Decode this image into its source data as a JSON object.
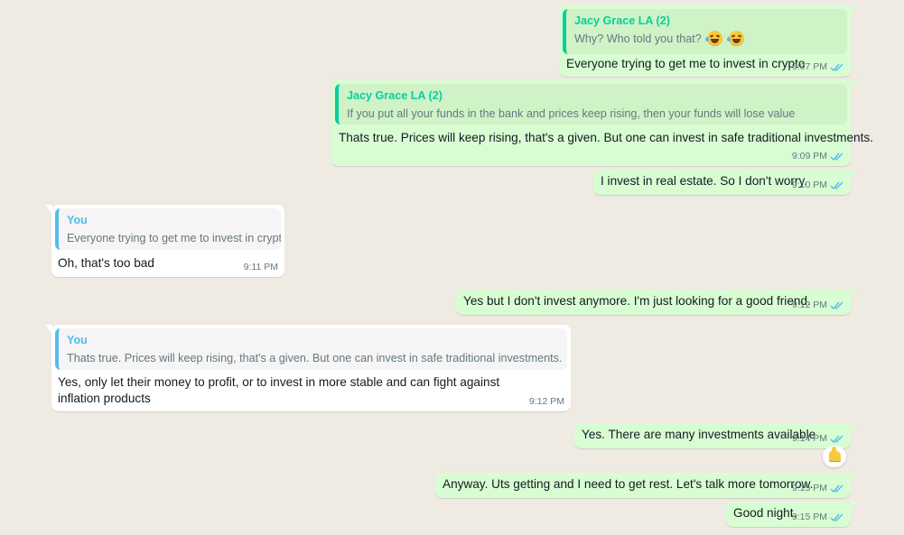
{
  "colors": {
    "background": "#efeae2",
    "outgoing_bubble": "#d9fdd3",
    "incoming_bubble": "#ffffff",
    "read_ticks": "#53bdeb",
    "quote_author_outgoing": "#06cf9c",
    "quote_author_incoming": "#53bdeb"
  },
  "messages": [
    {
      "quote": {
        "author": "Jacy Grace LA (2)",
        "text": "Why? Who told you that?"
      },
      "quote_emoji": [
        "laughing-tears-emoji",
        "laughing-tears-emoji"
      ],
      "text": "Everyone trying to get me to invest in crypto",
      "time": "9:07 PM",
      "status": "read"
    },
    {
      "quote": {
        "author": "Jacy Grace LA (2)",
        "text": "If you put all your funds in the bank and prices keep rising, then your funds will lose value"
      },
      "text": "Thats true. Prices will keep rising, that's a given. But one can invest in safe traditional investments.",
      "time": "9:09 PM",
      "status": "read"
    },
    {
      "text": "I invest in real estate. So I don't worry.",
      "time": "9:10 PM",
      "status": "read"
    },
    {
      "quote": {
        "author": "You",
        "text": "Everyone trying to get me to invest in crypto"
      },
      "text": "Oh, that's too bad",
      "time": "9:11 PM"
    },
    {
      "text": "Yes but I don't invest anymore. I'm just looking for a good friend.",
      "time": "9:12 PM",
      "status": "read"
    },
    {
      "quote": {
        "author": "You",
        "text": "Thats true. Prices will keep rising, that's a given. But one can invest in safe traditional investments."
      },
      "text": "Yes, only let their money to profit, or to invest in more stable and can fight against inflation products",
      "time": "9:12 PM"
    },
    {
      "text": "Yes. There are many investments available",
      "time": "9:14 PM",
      "status": "read",
      "reaction": "thumbs-up-emoji"
    },
    {
      "text": "Anyway. Uts getting and I need to get rest. Let's talk more tomorrow.",
      "time": "9:15 PM",
      "status": "read"
    },
    {
      "text": "Good night.",
      "time": "9:15 PM",
      "status": "read"
    }
  ]
}
